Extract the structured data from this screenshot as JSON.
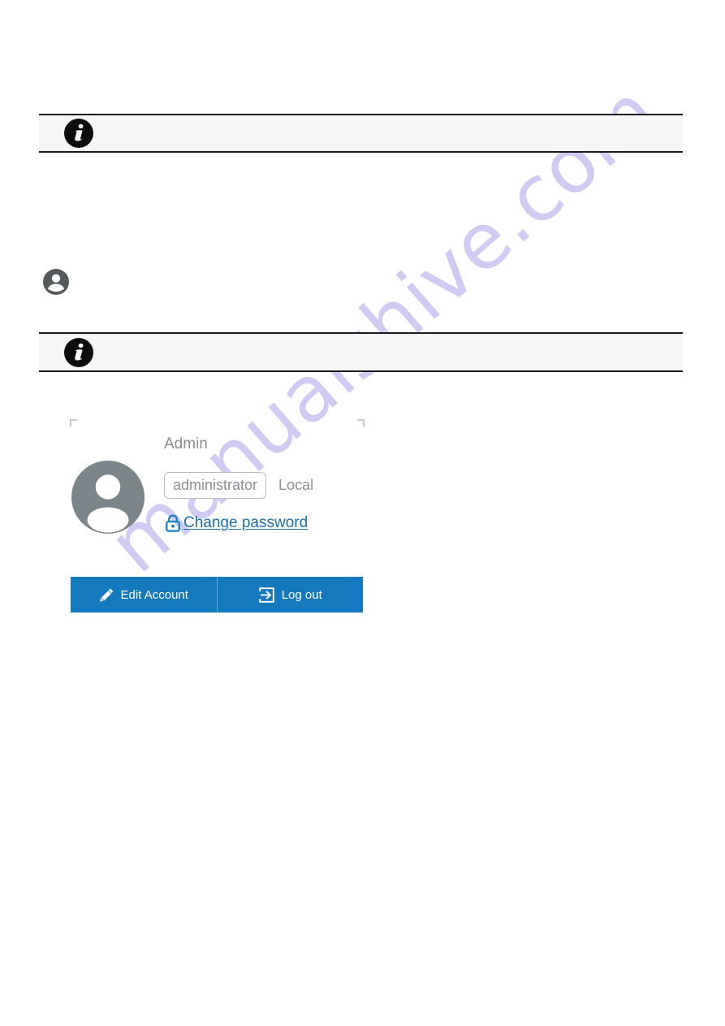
{
  "page": {
    "background_color": "#ffffff",
    "accent_color": "#1479bd",
    "link_color": "#1b6fa8",
    "muted_text_color": "#8a8f94",
    "banner_bg_color": "#f6f6f6",
    "banner_border_color": "#1a1a1a",
    "avatar_color": "#7c8589",
    "watermark_color": "#cdc9f2"
  },
  "watermark": {
    "text": "manualshive.com"
  },
  "banners": [
    {
      "icon": "info-icon",
      "text": ""
    },
    {
      "icon": "info-icon",
      "text": ""
    }
  ],
  "section": {
    "icon": "person-icon"
  },
  "account": {
    "avatar_icon": "user-avatar-icon",
    "display_name": "Admin",
    "username": "administrator",
    "username_placeholder": "administrator",
    "scope": "Local",
    "change_password": {
      "icon": "lock-icon",
      "label": "Change password"
    },
    "buttons": [
      {
        "icon": "pencil-icon",
        "label": "Edit Account"
      },
      {
        "icon": "logout-icon",
        "label": "Log out"
      }
    ]
  }
}
